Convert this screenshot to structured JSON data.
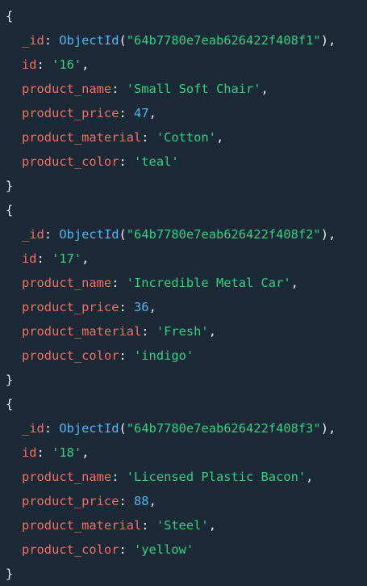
{
  "colors": {
    "background": "#1c2a38",
    "key": "#f0705f",
    "string": "#35d07f",
    "number": "#52b6ee",
    "function": "#52b6ee",
    "punctuation": "#e8eef3"
  },
  "documents": [
    {
      "open_brace": "{",
      "close_brace": "}",
      "oid_key": "_id",
      "oid_fn": "ObjectId",
      "oid_value": "\"64b7780e7eab626422f408f1\"",
      "id_key": "id",
      "id_value": "'16'",
      "name_key": "product_name",
      "name_value": "'Small Soft Chair'",
      "price_key": "product_price",
      "price_value": "47",
      "material_key": "product_material",
      "material_value": "'Cotton'",
      "color_key": "product_color",
      "color_value": "'teal'"
    },
    {
      "open_brace": "{",
      "close_brace": "}",
      "oid_key": "_id",
      "oid_fn": "ObjectId",
      "oid_value": "\"64b7780e7eab626422f408f2\"",
      "id_key": "id",
      "id_value": "'17'",
      "name_key": "product_name",
      "name_value": "'Incredible Metal Car'",
      "price_key": "product_price",
      "price_value": "36",
      "material_key": "product_material",
      "material_value": "'Fresh'",
      "color_key": "product_color",
      "color_value": "'indigo'"
    },
    {
      "open_brace": "{",
      "close_brace": "}",
      "oid_key": "_id",
      "oid_fn": "ObjectId",
      "oid_value": "\"64b7780e7eab626422f408f3\"",
      "id_key": "id",
      "id_value": "'18'",
      "name_key": "product_name",
      "name_value": "'Licensed Plastic Bacon'",
      "price_key": "product_price",
      "price_value": "88",
      "material_key": "product_material",
      "material_value": "'Steel'",
      "color_key": "product_color",
      "color_value": "'yellow'"
    }
  ]
}
